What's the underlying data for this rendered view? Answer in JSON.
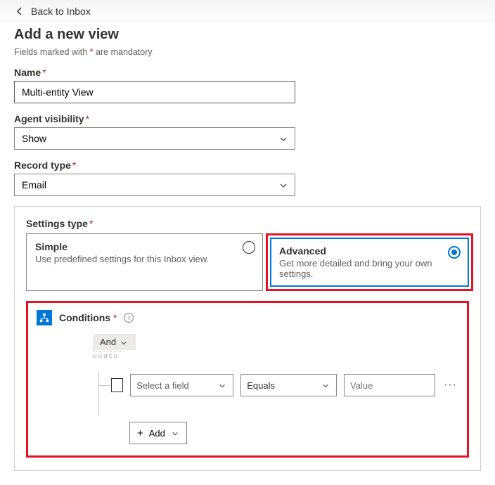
{
  "back_link": "Back to Inbox",
  "title": "Add a new view",
  "mandatory_prefix": "Fields marked with",
  "mandatory_star": "*",
  "mandatory_suffix": "are mandatory",
  "fields": {
    "name": {
      "label": "Name",
      "value": "Multi-entity View"
    },
    "agent_visibility": {
      "label": "Agent visibility",
      "value": "Show"
    },
    "record_type": {
      "label": "Record type",
      "value": "Email"
    },
    "settings_type": {
      "label": "Settings type"
    }
  },
  "settings_options": {
    "simple": {
      "title": "Simple",
      "desc": "Use predefined settings for this Inbox view.",
      "selected": false
    },
    "advanced": {
      "title": "Advanced",
      "desc": "Get more detailed and bring your own settings.",
      "selected": true
    }
  },
  "conditions": {
    "label": "Conditions",
    "logic": "And",
    "row": {
      "field_placeholder": "Select a field",
      "operator": "Equals",
      "value_placeholder": "Value"
    },
    "add_label": "Add",
    "more": "···"
  }
}
